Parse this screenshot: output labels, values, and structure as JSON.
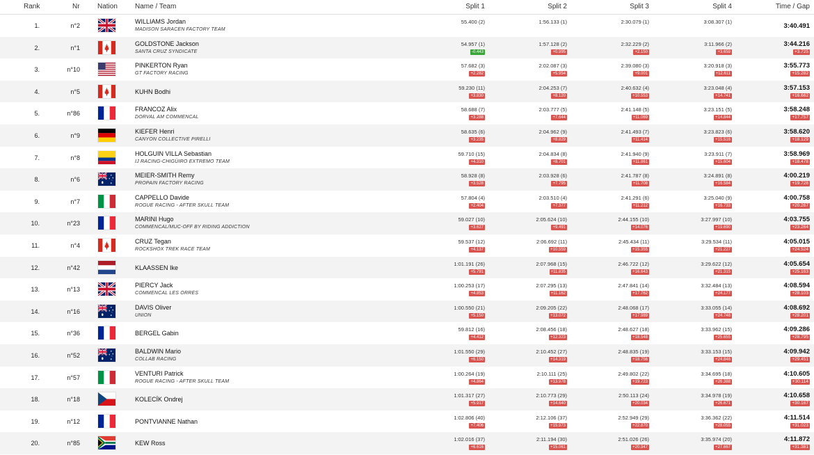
{
  "headers": {
    "rank": "Rank",
    "nr": "Nr",
    "nation": "Nation",
    "name_team": "Name / Team",
    "split1": "Split 1",
    "split2": "Split 2",
    "split3": "Split 3",
    "split4": "Split 4",
    "time_gap": "Time / Gap"
  },
  "colors": {
    "gap_red": "#d9534f",
    "gap_green": "#3aa63a",
    "stripe": "#f3f3f3"
  },
  "rows": [
    {
      "rank": "1.",
      "nr": "n°2",
      "nation": "gb",
      "name": "WILLIAMS Jordan",
      "team": "MADISON SARACEN FACTORY TEAM",
      "s1": "55.400 (2)",
      "s1g": "",
      "s2": "1:56.133 (1)",
      "s2g": "",
      "s3": "2:30.079 (1)",
      "s3g": "",
      "s4": "3:08.307 (1)",
      "s4g": "",
      "time": "3:40.491",
      "gap": ""
    },
    {
      "rank": "2.",
      "nr": "n°1",
      "nation": "ca",
      "name": "GOLDSTONE Jackson",
      "team": "SANTA CRUZ SYNDICATE",
      "s1": "54.957 (1)",
      "s1g": "-0.443",
      "s2": "1:57.128 (2)",
      "s2g": "+0.995",
      "s3": "2:32.229 (2)",
      "s3g": "+2.150",
      "s4": "3:11.966 (2)",
      "s4g": "+3.659",
      "time": "3:44.216",
      "gap": "+3.725"
    },
    {
      "rank": "3.",
      "nr": "n°10",
      "nation": "us",
      "name": "PINKERTON Ryan",
      "team": "GT FACTORY RACING",
      "s1": "57.682 (3)",
      "s1g": "+2.282",
      "s2": "2:02.087 (3)",
      "s2g": "+5.954",
      "s3": "2:39.080 (3)",
      "s3g": "+9.001",
      "s4": "3:20.918 (3)",
      "s4g": "+12.611",
      "time": "3:55.773",
      "gap": "+15.282"
    },
    {
      "rank": "4.",
      "nr": "n°5",
      "nation": "ca",
      "name": "KUHN Bodhi",
      "team": "",
      "s1": "59.230 (11)",
      "s1g": "+3.830",
      "s2": "2:04.253 (7)",
      "s2g": "+8.120",
      "s3": "2:40.632 (4)",
      "s3g": "+10.553",
      "s4": "3:23.048 (4)",
      "s4g": "+14.741",
      "time": "3:57.153",
      "gap": "+16.662"
    },
    {
      "rank": "5.",
      "nr": "n°86",
      "nation": "fr",
      "name": "FRANCOZ Alix",
      "team": "DORVAL AM COMMENCAL",
      "s1": "58.688 (7)",
      "s1g": "+3.288",
      "s2": "2:03.777 (5)",
      "s2g": "+7.644",
      "s3": "2:41.148 (5)",
      "s3g": "+11.069",
      "s4": "3:23.151 (5)",
      "s4g": "+14.844",
      "time": "3:58.248",
      "gap": "+17.757"
    },
    {
      "rank": "6.",
      "nr": "n°9",
      "nation": "de",
      "name": "KIEFER Henri",
      "team": "CANYON COLLECTIVE PIRELLI",
      "s1": "58.635 (6)",
      "s1g": "+3.235",
      "s2": "2:04.962 (9)",
      "s2g": "+8.829",
      "s3": "2:41.493 (7)",
      "s3g": "+11.414",
      "s4": "3:23.823 (6)",
      "s4g": "+15.516",
      "time": "3:58.620",
      "gap": "+18.129"
    },
    {
      "rank": "7.",
      "nr": "n°8",
      "nation": "co",
      "name": "HOLGUIN VILLA Sebastian",
      "team": "IJ RACING-CHIGÜIRO EXTREMO TEAM",
      "s1": "59.710 (15)",
      "s1g": "+4.310",
      "s2": "2:04.834 (8)",
      "s2g": "+8.701",
      "s3": "2:41.940 (9)",
      "s3g": "+11.861",
      "s4": "3:23.911 (7)",
      "s4g": "+15.604",
      "time": "3:58.969",
      "gap": "+18.478"
    },
    {
      "rank": "8.",
      "nr": "n°6",
      "nation": "au",
      "name": "MEIER-SMITH Remy",
      "team": "PROPAIN FACTORY RACING",
      "s1": "58.928 (8)",
      "s1g": "+3.528",
      "s2": "2:03.928 (6)",
      "s2g": "+7.795",
      "s3": "2:41.787 (8)",
      "s3g": "+11.708",
      "s4": "3:24.891 (8)",
      "s4g": "+16.584",
      "time": "4:00.219",
      "gap": "+19.728"
    },
    {
      "rank": "9.",
      "nr": "n°7",
      "nation": "it",
      "name": "CAPPELLO Davide",
      "team": "ROGUE RACING - AFTER SKULL TEAM",
      "s1": "57.804 (4)",
      "s1g": "+2.404",
      "s2": "2:03.510 (4)",
      "s2g": "+7.377",
      "s3": "2:41.291 (6)",
      "s3g": "+11.212",
      "s4": "3:25.040 (9)",
      "s4g": "+16.733",
      "time": "4:00.758",
      "gap": "+20.267"
    },
    {
      "rank": "10.",
      "nr": "n°23",
      "nation": "fr",
      "name": "MARINI Hugo",
      "team": "COMMENCAL/MUC-OFF BY RIDING ADDICTION",
      "s1": "59.027 (10)",
      "s1g": "+3.627",
      "s2": "2:05.624 (10)",
      "s2g": "+9.491",
      "s3": "2:44.155 (10)",
      "s3g": "+14.076",
      "s4": "3:27.997 (10)",
      "s4g": "+19.690",
      "time": "4:03.755",
      "gap": "+23.264"
    },
    {
      "rank": "11.",
      "nr": "n°4",
      "nation": "ca",
      "name": "CRUZ Tegan",
      "team": "ROCKSHOX TREK RACE TEAM",
      "s1": "59.537 (12)",
      "s1g": "+4.137",
      "s2": "2:06.692 (11)",
      "s2g": "+10.559",
      "s3": "2:45.434 (11)",
      "s3g": "+15.355",
      "s4": "3:29.534 (11)",
      "s4g": "+21.227",
      "time": "4:05.015",
      "gap": "+24.524"
    },
    {
      "rank": "12.",
      "nr": "n°42",
      "nation": "nl",
      "name": "KLAASSEN Ike",
      "team": "",
      "s1": "1:01.191 (26)",
      "s1g": "+5.791",
      "s2": "2:07.968 (15)",
      "s2g": "+11.835",
      "s3": "2:46.722 (12)",
      "s3g": "+16.643",
      "s4": "3:29.622 (12)",
      "s4g": "+21.315",
      "time": "4:05.654",
      "gap": "+25.163"
    },
    {
      "rank": "13.",
      "nr": "n°13",
      "nation": "gb",
      "name": "PIERCY Jack",
      "team": "COMMENCAL LES ORRES",
      "s1": "1:00.253 (17)",
      "s1g": "+4.853",
      "s2": "2:07.295 (13)",
      "s2g": "+11.162",
      "s3": "2:47.841 (14)",
      "s3g": "+17.762",
      "s4": "3:32.484 (13)",
      "s4g": "+24.177",
      "time": "4:08.594",
      "gap": "+28.103"
    },
    {
      "rank": "14.",
      "nr": "n°16",
      "nation": "au",
      "name": "DAVIS Oliver",
      "team": "UNION",
      "s1": "1:00.550 (21)",
      "s1g": "+5.150",
      "s2": "2:09.205 (22)",
      "s2g": "+13.072",
      "s3": "2:48.068 (17)",
      "s3g": "+17.989",
      "s4": "3:33.055 (14)",
      "s4g": "+24.748",
      "time": "4:08.692",
      "gap": "+28.201"
    },
    {
      "rank": "15.",
      "nr": "n°36",
      "nation": "fr",
      "name": "BERGEL Gabin",
      "team": "",
      "s1": "59.812 (16)",
      "s1g": "+4.412",
      "s2": "2:08.456 (18)",
      "s2g": "+12.323",
      "s3": "2:48.627 (18)",
      "s3g": "+18.548",
      "s4": "3:33.962 (15)",
      "s4g": "+25.655",
      "time": "4:09.286",
      "gap": "+28.795"
    },
    {
      "rank": "16.",
      "nr": "n°52",
      "nation": "au",
      "name": "BALDWIN Mario",
      "team": "COLLAB RACING",
      "s1": "1:01.550 (29)",
      "s1g": "+6.150",
      "s2": "2:10.452 (27)",
      "s2g": "+14.319",
      "s3": "2:48.835 (19)",
      "s3g": "+18.756",
      "s4": "3:33.153 (15)",
      "s4g": "+24.846",
      "time": "4:09.942",
      "gap": "+29.451"
    },
    {
      "rank": "17.",
      "nr": "n°57",
      "nation": "it",
      "name": "VENTURI Patrick",
      "team": "ROGUE RACING - AFTER SKULL TEAM",
      "s1": "1:00.264 (19)",
      "s1g": "+4.864",
      "s2": "2:10.111 (25)",
      "s2g": "+13.978",
      "s3": "2:49.802 (22)",
      "s3g": "+19.723",
      "s4": "3:34.695 (18)",
      "s4g": "+26.388",
      "time": "4:10.605",
      "gap": "+30.114"
    },
    {
      "rank": "18.",
      "nr": "n°18",
      "nation": "cz",
      "name": "KOLECÍK Ondrej",
      "team": "",
      "s1": "1:01.317 (27)",
      "s1g": "+5.917",
      "s2": "2:10.773 (29)",
      "s2g": "+14.640",
      "s3": "2:50.113 (24)",
      "s3g": "+20.034",
      "s4": "3:34.978 (19)",
      "s4g": "+26.671",
      "time": "4:10.658",
      "gap": "+30.167"
    },
    {
      "rank": "19.",
      "nr": "n°12",
      "nation": "fr",
      "name": "PONTVIANNE Nathan",
      "team": "",
      "s1": "1:02.806 (40)",
      "s1g": "+7.406",
      "s2": "2:12.106 (37)",
      "s2g": "+15.973",
      "s3": "2:52.949 (29)",
      "s3g": "+22.870",
      "s4": "3:36.362 (22)",
      "s4g": "+28.055",
      "time": "4:11.514",
      "gap": "+31.023"
    },
    {
      "rank": "20.",
      "nr": "n°85",
      "nation": "za",
      "name": "KEW Ross",
      "team": "",
      "s1": "1:02.016 (37)",
      "s1g": "+6.616",
      "s2": "2:11.194 (30)",
      "s2g": "+15.061",
      "s3": "2:51.026 (26)",
      "s3g": "+20.947",
      "s4": "3:35.974 (20)",
      "s4g": "+27.667",
      "time": "4:11.872",
      "gap": "+31.381"
    }
  ]
}
